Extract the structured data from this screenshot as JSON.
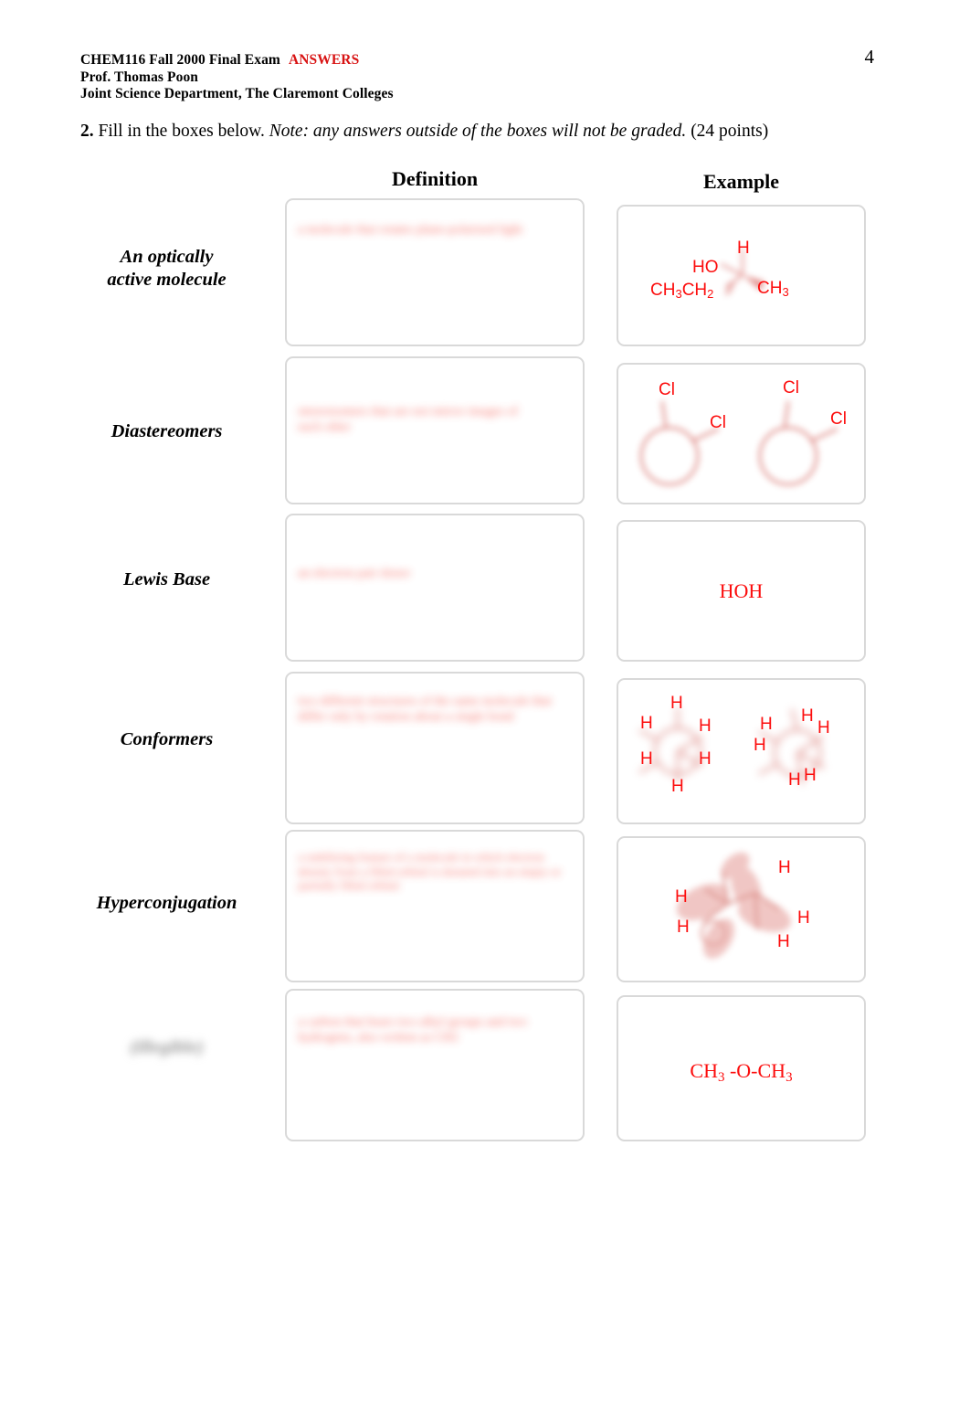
{
  "document": {
    "page_number": "4",
    "header": {
      "line1_main": "CHEM116 Fall 2000 Final Exam",
      "line1_answers": "ANSWERS",
      "line2": "Prof. Thomas Poon",
      "line3": "Joint Science Department, The Claremont Colleges"
    },
    "question": {
      "number": "2.",
      "text": "Fill in the boxes below.",
      "note": "Note: any answers outside of the boxes will not be graded.",
      "points": "(24 points)"
    },
    "columns": {
      "definition": "Definition",
      "example": "Example"
    },
    "rows": [
      {
        "term": "An optically\nactive molecule",
        "term_redacted": false,
        "definition_answer": "a molecule that rotates plane-polarized light",
        "example": {
          "kind": "wedge-dash-stereocenter",
          "labels": [
            "H",
            "HO",
            "CH3CH2",
            "CH3"
          ]
        }
      },
      {
        "term": "Diastereomers",
        "term_redacted": false,
        "definition_answer": "stereoisomers that are not mirror images of each other",
        "example": {
          "kind": "two-cyclohexane-rings",
          "labels": [
            "Cl",
            "Cl",
            "Cl",
            "Cl"
          ]
        }
      },
      {
        "term": "Lewis Base",
        "term_redacted": false,
        "definition_answer": "an electron pair donor",
        "example": {
          "kind": "formula",
          "formula": "HOH"
        }
      },
      {
        "term": "Conformers",
        "term_redacted": false,
        "definition_answer": "two different structures of the same molecule that differ only by rotation about a single bond",
        "example": {
          "kind": "two-newman-projections",
          "labels": [
            "H",
            "H",
            "H",
            "H",
            "H",
            "H",
            "H",
            "H",
            "H",
            "H",
            "H",
            "H"
          ]
        }
      },
      {
        "term": "Hyperconjugation",
        "term_redacted": false,
        "definition_answer": "a stabilizing feature of a molecule in which electron density from a filled orbital is donated into an empty or partially filled orbital",
        "example": {
          "kind": "orbital-overlap",
          "labels": [
            "H",
            "H",
            "H",
            "H",
            "H"
          ]
        }
      },
      {
        "term": "(illegible)",
        "term_redacted": true,
        "definition_answer": "a carbon that bears two alkyl groups and two hydrogens, also written as CH2",
        "example": {
          "kind": "formula-subscript",
          "formula_parts": [
            "CH",
            "3",
            " -O-CH",
            "3"
          ]
        }
      }
    ]
  },
  "colors": {
    "answer_red": "#f4594f",
    "structure_red": "#fc0d0d",
    "header_red": "#d81313",
    "box_border": "#d9d9d9",
    "text_black": "#000000"
  }
}
